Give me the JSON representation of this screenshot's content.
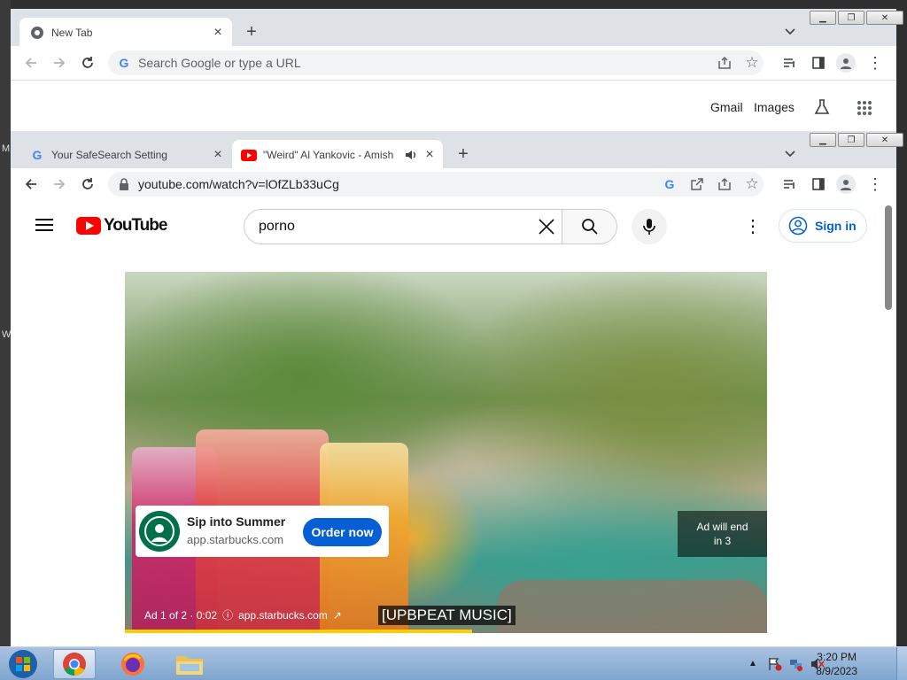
{
  "desktop": {
    "glyphs": [
      "M",
      "W"
    ]
  },
  "back_window": {
    "tab": {
      "title": "New Tab"
    },
    "omnibox": {
      "placeholder": "Search Google or type a URL"
    },
    "links": {
      "gmail": "Gmail",
      "images": "Images"
    }
  },
  "front_window": {
    "tabs": [
      {
        "title": "Your SafeSearch Setting",
        "active": false
      },
      {
        "title": "\"Weird\" Al Yankovic - Amish",
        "active": true
      }
    ],
    "omnibox": {
      "url": "youtube.com/watch?v=lOfZLb33uCg"
    }
  },
  "youtube": {
    "logo_text": "YouTube",
    "search_value": "porno",
    "sign_in_label": "Sign in",
    "ad": {
      "title": "Sip into Summer",
      "url": "app.starbucks.com",
      "cta": "Order now",
      "end_line1": "Ad will end",
      "end_line2": "in 3",
      "info": "Ad 1 of 2 · 0:02",
      "info_url": "app.starbucks.com",
      "progress": 0.54
    },
    "caption": "[UPBPEAT MUSIC]"
  },
  "taskbar": {
    "time": "3:20 PM",
    "date": "8/9/2023"
  },
  "colors": {
    "youtube_red": "#ff0000",
    "link_blue": "#065fd4",
    "starbucks_green": "#00704a"
  }
}
